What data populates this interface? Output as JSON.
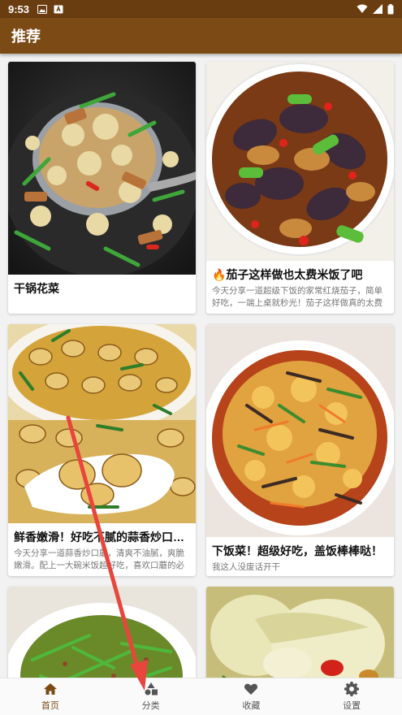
{
  "status_bar": {
    "time": "9:53"
  },
  "app_bar": {
    "title": "推荐"
  },
  "cards": [
    {
      "title": "干锅花菜",
      "desc": ""
    },
    {
      "title": "🔥茄子这样做也太费米饭了吧",
      "desc": "今天分享一道超级下饭的家常红烧茄子，简单好吃，一端上桌就秒光！茄子这样做真的太费米…"
    },
    {
      "title": "鲜香嫩滑！好吃不腻的蒜香炒口蘑！",
      "desc": "今天分享一道蒜香炒口蘑，清爽不油腻，爽脆嫩滑。配上一大碗米饭超好吃，喜欢口蘑的必须…"
    },
    {
      "title": "下饭菜！超级好吃，盖饭棒棒哒！",
      "desc": "我这人没废话开干"
    }
  ],
  "bottom_nav": [
    {
      "label": "首页",
      "icon": "home-icon",
      "active": true
    },
    {
      "label": "分类",
      "icon": "category-icon",
      "active": false
    },
    {
      "label": "收藏",
      "icon": "heart-icon",
      "active": false
    },
    {
      "label": "设置",
      "icon": "gear-icon",
      "active": false
    }
  ],
  "colors": {
    "accent": "#7b4a15",
    "status_bar": "#6a3d10",
    "annotation_arrow": "#e8453c"
  }
}
